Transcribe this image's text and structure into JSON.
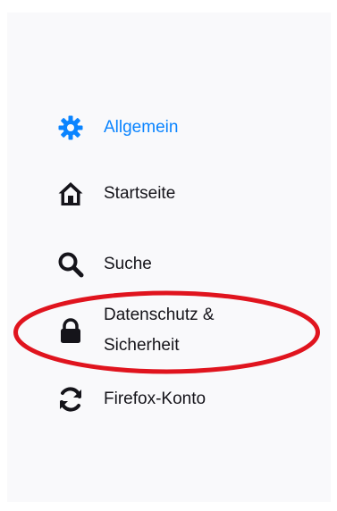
{
  "sidebar": {
    "items": [
      {
        "label": "Allgemein",
        "icon": "gear-icon",
        "active": true
      },
      {
        "label": "Startseite",
        "icon": "home-icon",
        "active": false
      },
      {
        "label": "Suche",
        "icon": "search-icon",
        "active": false
      },
      {
        "label_line1": "Datenschutz &",
        "label_line2": "Sicherheit",
        "icon": "lock-icon",
        "active": false,
        "highlighted": true
      },
      {
        "label": "Firefox-Konto",
        "icon": "sync-icon",
        "active": false
      }
    ]
  },
  "colors": {
    "active": "#0a84ff",
    "text": "#15141a",
    "annotation": "#e0141e",
    "panel_bg": "#f9f9fb"
  }
}
